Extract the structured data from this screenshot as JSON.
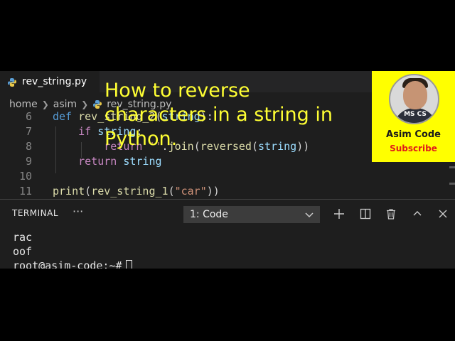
{
  "tab": {
    "filename": "rev_string.py"
  },
  "breadcrumb": {
    "items": [
      "home",
      "asim",
      "rev_string.py"
    ]
  },
  "editor": {
    "lines": [
      {
        "num": "6",
        "parts": [
          {
            "t": "def ",
            "c": "kw2"
          },
          {
            "t": "rev_string_2",
            "c": "fn"
          },
          {
            "t": "(",
            "c": ""
          },
          {
            "t": "string",
            "c": "var"
          },
          {
            "t": "):",
            "c": ""
          }
        ]
      },
      {
        "num": "7",
        "parts": [
          {
            "t": "    ",
            "c": ""
          },
          {
            "t": "if ",
            "c": "kw"
          },
          {
            "t": "string",
            "c": "var"
          },
          {
            "t": ":",
            "c": ""
          }
        ]
      },
      {
        "num": "8",
        "parts": [
          {
            "t": "        ",
            "c": ""
          },
          {
            "t": "return ",
            "c": "kw"
          },
          {
            "t": "''",
            "c": "str"
          },
          {
            "t": ".",
            "c": ""
          },
          {
            "t": "join",
            "c": "fn"
          },
          {
            "t": "(",
            "c": ""
          },
          {
            "t": "reversed",
            "c": "fn"
          },
          {
            "t": "(",
            "c": ""
          },
          {
            "t": "string",
            "c": "var"
          },
          {
            "t": "))",
            "c": ""
          }
        ]
      },
      {
        "num": "9",
        "parts": [
          {
            "t": "    ",
            "c": ""
          },
          {
            "t": "return ",
            "c": "kw"
          },
          {
            "t": "string",
            "c": "var"
          }
        ]
      },
      {
        "num": "10",
        "parts": []
      },
      {
        "num": "11",
        "parts": [
          {
            "t": "print",
            "c": "fn"
          },
          {
            "t": "(",
            "c": ""
          },
          {
            "t": "rev_string_1",
            "c": "fn"
          },
          {
            "t": "(",
            "c": ""
          },
          {
            "t": "\"car\"",
            "c": "str"
          },
          {
            "t": "))",
            "c": ""
          }
        ]
      }
    ]
  },
  "panel": {
    "tab_label": "TERMINAL",
    "more_label": "···",
    "terminal_select": "1: Code",
    "output": [
      "rac",
      "oof"
    ],
    "prompt": "root@asim-code:~#"
  },
  "overlay": {
    "title_lines": [
      "How to reverse",
      "characters in a string in",
      "Python."
    ]
  },
  "badge": {
    "avatar_text": "MS CS",
    "name": "Asim Code",
    "subscribe": "Subscribe"
  },
  "colors": {
    "title": "#ffff33",
    "badge_bg": "#ffff00",
    "subscribe": "#e01a1a"
  }
}
